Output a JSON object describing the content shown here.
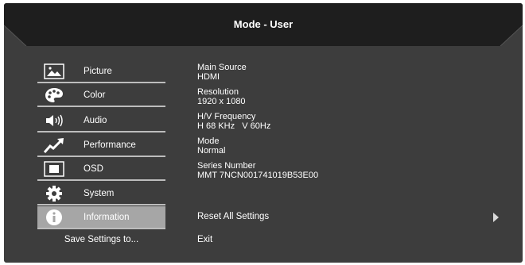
{
  "header": {
    "title": "Mode - User"
  },
  "menu": {
    "items": [
      {
        "label": "Picture",
        "icon": "picture-icon",
        "selected": false
      },
      {
        "label": "Color",
        "icon": "palette-icon",
        "selected": false
      },
      {
        "label": "Audio",
        "icon": "speaker-icon",
        "selected": false
      },
      {
        "label": "Performance",
        "icon": "trend-arrow-icon",
        "selected": false
      },
      {
        "label": "OSD",
        "icon": "osd-window-icon",
        "selected": false
      },
      {
        "label": "System",
        "icon": "gear-icon",
        "selected": false
      },
      {
        "label": "Information",
        "icon": "info-icon",
        "selected": true
      }
    ],
    "save_label": "Save Settings to..."
  },
  "info": [
    {
      "label": "Main Source",
      "value": "HDMI"
    },
    {
      "label": "Resolution",
      "value": "1920 x 1080"
    },
    {
      "label": "H/V Frequency",
      "value": "H 68 KHz   V 60Hz"
    },
    {
      "label": "Mode",
      "value": "Normal"
    },
    {
      "label": "Series Number",
      "value": "MMT 7NCN001741019B53E00"
    }
  ],
  "actions": {
    "reset_label": "Reset All Settings",
    "exit_label": "Exit"
  },
  "colors": {
    "background": "#3d3d3d",
    "header": "#1e1e1e",
    "selected": "#a6a6a6",
    "text": "#ffffff"
  }
}
